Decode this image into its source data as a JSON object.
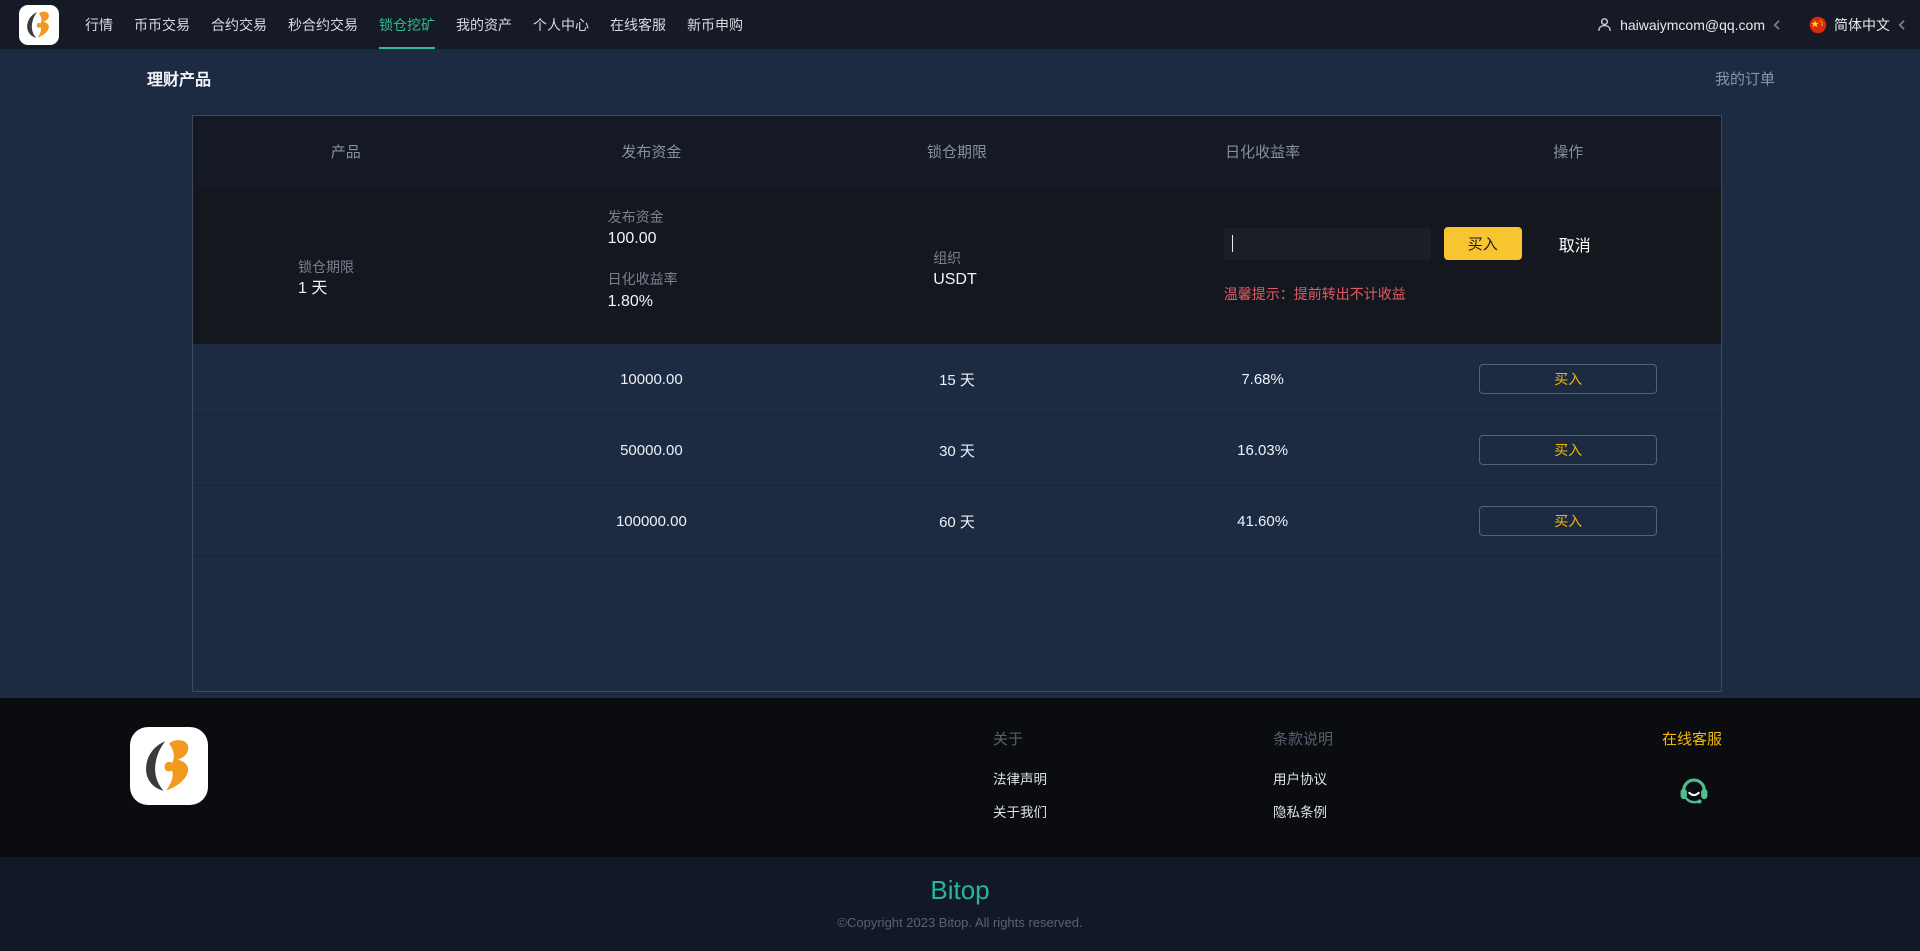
{
  "nav": {
    "items": [
      {
        "label": "行情",
        "active": false
      },
      {
        "label": "币币交易",
        "active": false
      },
      {
        "label": "合约交易",
        "active": false
      },
      {
        "label": "秒合约交易",
        "active": false
      },
      {
        "label": "锁仓挖矿",
        "active": true
      },
      {
        "label": "我的资产",
        "active": false
      },
      {
        "label": "个人中心",
        "active": false
      },
      {
        "label": "在线客服",
        "active": false
      },
      {
        "label": "新币申购",
        "active": false
      }
    ],
    "account_email": "haiwaiymcom@qq.com",
    "language": "简体中文",
    "icons": [
      "bitop-logo",
      "user-icon",
      "chevron-icon",
      "china-flag-icon"
    ]
  },
  "page": {
    "title": "理财产品",
    "my_orders": "我的订单"
  },
  "table": {
    "headers": [
      "产品",
      "发布资金",
      "锁仓期限",
      "日化收益率",
      "操作"
    ],
    "expanded": {
      "lock_period_label": "锁仓期限",
      "lock_period_value": "1 天",
      "publish_funds_label": "发布资金",
      "publish_funds_value": "100.00",
      "daily_rate_label": "日化收益率",
      "daily_rate_value": "1.80%",
      "org_label": "组织",
      "org_value": "USDT",
      "amount_input_value": "",
      "buy_label": "买入",
      "cancel_label": "取消",
      "warning": "温馨提示：提前转出不计收益"
    },
    "rows": [
      {
        "funds": "10000.00",
        "period": "15 天",
        "rate": "7.68%",
        "action": "买入"
      },
      {
        "funds": "50000.00",
        "period": "30 天",
        "rate": "16.03%",
        "action": "买入"
      },
      {
        "funds": "100000.00",
        "period": "60 天",
        "rate": "41.60%",
        "action": "买入"
      }
    ]
  },
  "footer": {
    "about": {
      "title": "关于",
      "links": [
        "法律声明",
        "关于我们"
      ]
    },
    "terms": {
      "title": "条款说明",
      "links": [
        "用户协议",
        "隐私条例"
      ]
    },
    "support": {
      "title": "在线客服",
      "icon": "headset-icon"
    },
    "brand": "Bitop",
    "copyright": "©Copyright 2023 Bitop. All rights reserved."
  },
  "colors": {
    "accent_yellow": "#f8c42f",
    "accent_teal": "#2ebd96",
    "warning_red": "#e25a65",
    "headset_green": "#4fbe8c",
    "page_bg": "#1c2a42",
    "nav_bg": "#161a24",
    "table_header_bg": "#141925",
    "expanded_row_bg": "#15171e",
    "footer_bg": "#0b0c10"
  }
}
